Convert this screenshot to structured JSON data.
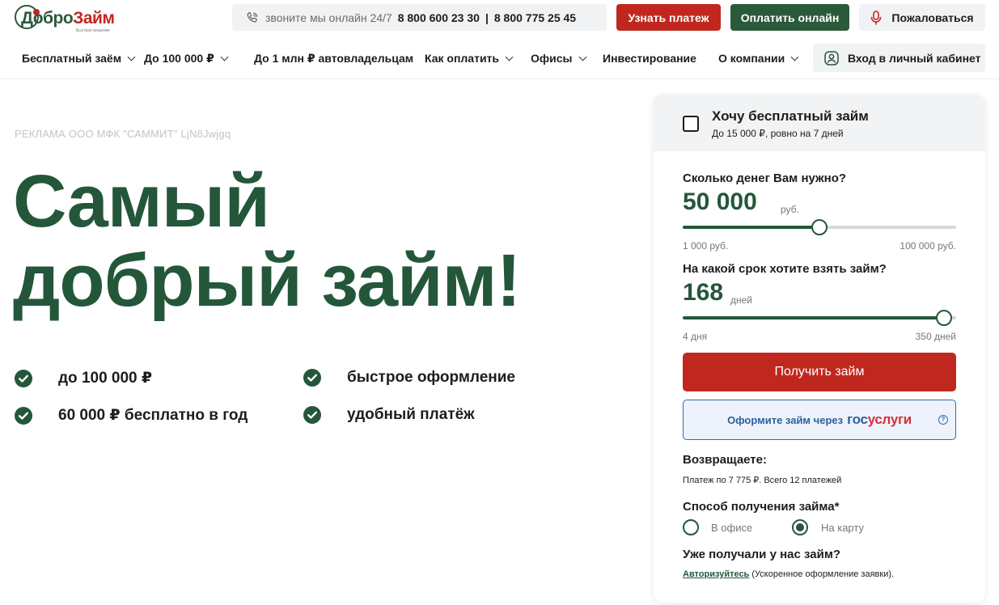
{
  "brand": {
    "logo_part1": "Добро",
    "logo_part2": "Займ",
    "logo_tagline": "Быстрое решение"
  },
  "topbar": {
    "phone_label": "звоните мы онлайн 24/7",
    "phone_1": "8 800 600 23 30",
    "phone_separator": "|",
    "phone_2": "8 800 775 25 45",
    "btn_payment_info": "Узнать платеж",
    "btn_pay_online": "Оплатить онлайн",
    "btn_complain": "Пожаловаться"
  },
  "nav": {
    "items": [
      {
        "label": "Бесплатный заём"
      },
      {
        "label": "До 100 000 ₽"
      },
      {
        "label": "До 1 млн ₽ автовладельцам"
      },
      {
        "label": "Как оплатить"
      },
      {
        "label": "Офисы"
      },
      {
        "label": "Инвестирование"
      },
      {
        "label": "О компании"
      }
    ],
    "cabinet": "Вход в личный кабинет"
  },
  "hero": {
    "ad_note": "РЕКЛАМА ООО МФК \"САММИТ\" LjN8Jwjgq",
    "title_line1": "Самый",
    "title_line2": "добрый займ!",
    "features": [
      "до 100 000 ₽",
      "быстрое оформление",
      "60 000 ₽ бесплатно в год",
      "удобный платёж"
    ]
  },
  "calculator": {
    "free_title": "Хочу бесплатный займ",
    "free_sub": "До 15 000 ₽, ровно на 7 дней",
    "amount_question": "Сколько денег Вам нужно?",
    "amount_value": "50 000",
    "amount_unit": "руб.",
    "amount_level": 0.5,
    "amount_min": "1 000 руб.",
    "amount_max": "100 000 руб.",
    "term_question": "На какой срок хотите взять займ?",
    "term_value": "168",
    "term_unit": "дней",
    "term_level": 0.955,
    "term_min": "4 дня",
    "term_max": "350 дней",
    "get_button": "Получить займ",
    "gos_text": "Оформите займ через",
    "gos_logo_1": "гос",
    "gos_logo_2": "услуги",
    "help_symbol": "?",
    "return_title": "Возвращаете:",
    "return_detail": "Платеж по 7 775 ₽. Всего 12 платежей",
    "method_title": "Способ получения займа*",
    "method_office": "В офисе",
    "method_card": "На карту",
    "returning_title": "Уже получали у нас займ?",
    "auth_link": "Авторизуйтесь",
    "auth_note": " (Ускоренное оформление заявки)."
  },
  "colors": {
    "brand_green": "#24573a",
    "brand_red": "#c0281f",
    "gos_blue": "#2f5f9e",
    "gos_red": "#d7303b"
  }
}
